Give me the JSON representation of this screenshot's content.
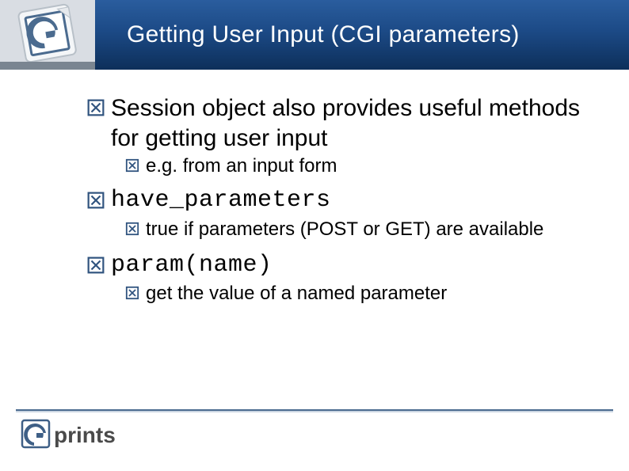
{
  "slide": {
    "title": "Getting User Input (CGI parameters)",
    "bullets": [
      {
        "text": "Session object also provides useful methods for getting user input",
        "mono": false,
        "sub": [
          {
            "text": "e.g. from an input form"
          }
        ]
      },
      {
        "text": "have_parameters",
        "mono": true,
        "sub": [
          {
            "text": "true if parameters (POST or GET) are available"
          }
        ]
      },
      {
        "text": "param(name)",
        "mono": true,
        "sub": [
          {
            "text": "get the value of a named parameter"
          }
        ]
      }
    ]
  },
  "branding": {
    "footer_logo_text_main": "prints",
    "footer_logo_letter": "e"
  }
}
